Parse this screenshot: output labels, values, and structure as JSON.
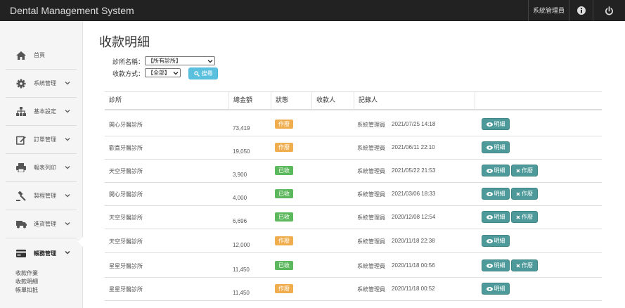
{
  "header": {
    "app_title": "Dental Management System",
    "user_label": "系統管理員",
    "info_icon": "info-icon",
    "power_icon": "power-icon"
  },
  "sidebar": {
    "items": [
      {
        "label": "首頁",
        "icon": "home-icon",
        "has_chevron": false
      },
      {
        "label": "系統管理",
        "icon": "gear-icon",
        "has_chevron": true
      },
      {
        "label": "基本設定",
        "icon": "sitemap-icon",
        "has_chevron": true
      },
      {
        "label": "訂單管理",
        "icon": "edit-icon",
        "has_chevron": true
      },
      {
        "label": "報表列印",
        "icon": "printer-icon",
        "has_chevron": true
      },
      {
        "label": "製程管理",
        "icon": "gavel-icon",
        "has_chevron": true
      },
      {
        "label": "進貨管理",
        "icon": "truck-icon",
        "has_chevron": true
      },
      {
        "label": "帳務管理",
        "icon": "card-icon",
        "has_chevron": true
      }
    ],
    "submenu": [
      "收款作業",
      "收款明細",
      "帳單扣抵"
    ]
  },
  "page": {
    "title": "收款明細"
  },
  "filters": {
    "clinic_label": "診所名稱：",
    "clinic_value": "【所有診所】",
    "method_label": "收款方式：",
    "method_value": "【全部】",
    "search_label": "搜尋"
  },
  "table": {
    "columns": [
      "診所",
      "總金額",
      "狀態",
      "收款人",
      "記錄人"
    ],
    "detail_label": "明細",
    "void_label": "作廢",
    "rows": [
      {
        "clinic": "開心牙醫診所",
        "amount": "73,419",
        "status": "作廢",
        "status_type": "void",
        "payee": "",
        "recorder": "系統管理員",
        "datetime": "2021/07/25 14:18",
        "can_void": false
      },
      {
        "clinic": "歡喜牙醫診所",
        "amount": "19,050",
        "status": "作廢",
        "status_type": "void",
        "payee": "",
        "recorder": "系統管理員",
        "datetime": "2021/06/11 22:10",
        "can_void": false
      },
      {
        "clinic": "天空牙醫診所",
        "amount": "3,900",
        "status": "已收",
        "status_type": "paid",
        "payee": "",
        "recorder": "系統管理員",
        "datetime": "2021/05/22 21:53",
        "can_void": true
      },
      {
        "clinic": "開心牙醫診所",
        "amount": "4,000",
        "status": "已收",
        "status_type": "paid",
        "payee": "",
        "recorder": "系統管理員",
        "datetime": "2021/03/06 18:33",
        "can_void": true
      },
      {
        "clinic": "天空牙醫診所",
        "amount": "6,696",
        "status": "已收",
        "status_type": "paid",
        "payee": "",
        "recorder": "系統管理員",
        "datetime": "2020/12/08 12:54",
        "can_void": true
      },
      {
        "clinic": "天空牙醫診所",
        "amount": "12,000",
        "status": "作廢",
        "status_type": "void",
        "payee": "",
        "recorder": "系統管理員",
        "datetime": "2020/11/18 22:38",
        "can_void": false
      },
      {
        "clinic": "星星牙醫診所",
        "amount": "11,450",
        "status": "已收",
        "status_type": "paid",
        "payee": "",
        "recorder": "系統管理員",
        "datetime": "2020/11/18 00:56",
        "can_void": true
      },
      {
        "clinic": "星星牙醫診所",
        "amount": "11,450",
        "status": "作廢",
        "status_type": "void",
        "payee": "",
        "recorder": "系統管理員",
        "datetime": "2020/11/18 00:52",
        "can_void": false
      }
    ]
  },
  "colors": {
    "topbar": "#222222",
    "void_badge": "#f0ad4e",
    "paid_badge": "#5cb85c",
    "action_button": "#4e9a9a",
    "search_button": "#5bc0de"
  }
}
